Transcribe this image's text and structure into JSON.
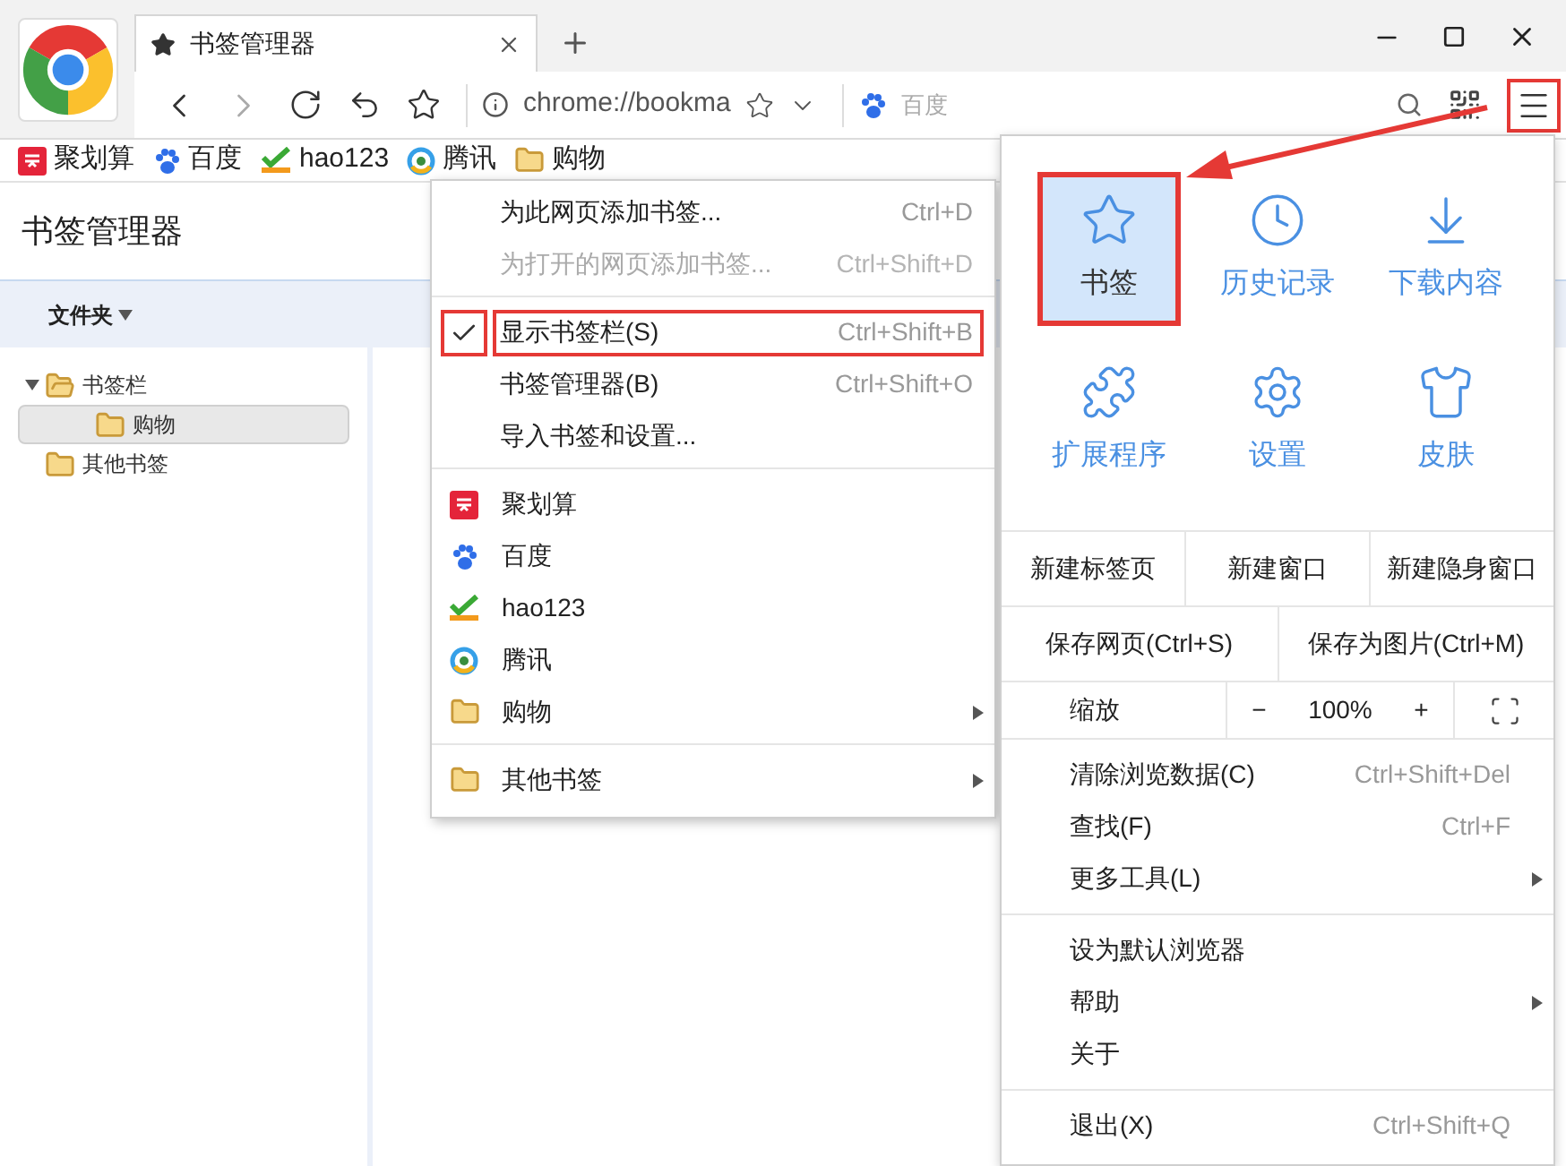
{
  "browser": {
    "tab_title": "书签管理器",
    "address": "chrome://bookma",
    "search_placeholder": "百度",
    "menu_button_highlighted": true
  },
  "bookmarks_bar": [
    {
      "label": "聚划算",
      "kind": "ju"
    },
    {
      "label": "百度",
      "kind": "baidu"
    },
    {
      "label": "hao123",
      "kind": "hao"
    },
    {
      "label": "腾讯",
      "kind": "tencent"
    },
    {
      "label": "购物",
      "kind": "folder"
    }
  ],
  "page": {
    "title": "书签管理器",
    "folder_menu": "文件夹",
    "tree": [
      {
        "label": "书签栏",
        "expanded": true,
        "selected": false,
        "children": [
          {
            "label": "购物",
            "selected": true
          }
        ]
      },
      {
        "label": "其他书签",
        "expanded": false,
        "selected": false
      }
    ]
  },
  "context_menu": {
    "sections": [
      [
        {
          "kind": "command",
          "label": "为此网页添加书签...",
          "shortcut": "Ctrl+D",
          "disabled": false,
          "checked": false,
          "highlighted": false
        },
        {
          "kind": "command",
          "label": "为打开的网页添加书签...",
          "shortcut": "Ctrl+Shift+D",
          "disabled": true,
          "checked": false,
          "highlighted": false
        }
      ],
      [
        {
          "kind": "command",
          "label": "显示书签栏(S)",
          "shortcut": "Ctrl+Shift+B",
          "disabled": false,
          "checked": true,
          "highlighted": true
        },
        {
          "kind": "command",
          "label": "书签管理器(B)",
          "shortcut": "Ctrl+Shift+O",
          "disabled": false,
          "checked": false,
          "highlighted": false
        },
        {
          "kind": "command",
          "label": "导入书签和设置...",
          "disabled": false,
          "checked": false,
          "highlighted": false
        }
      ],
      [
        {
          "kind": "ju",
          "label": "聚划算",
          "submenu": false
        },
        {
          "kind": "baidu",
          "label": "百度",
          "submenu": false
        },
        {
          "kind": "hao",
          "label": "hao123",
          "submenu": false
        },
        {
          "kind": "tencent",
          "label": "腾讯",
          "submenu": false
        },
        {
          "kind": "folder",
          "label": "购物",
          "submenu": true
        }
      ],
      [
        {
          "kind": "folder",
          "label": "其他书签",
          "submenu": true
        }
      ]
    ]
  },
  "main_menu": {
    "tiles": [
      {
        "kind": "star",
        "label": "书签",
        "selected": true,
        "highlighted": true
      },
      {
        "kind": "clock",
        "label": "历史记录",
        "selected": false,
        "highlighted": false
      },
      {
        "kind": "download",
        "label": "下载内容",
        "selected": false,
        "highlighted": false
      },
      {
        "kind": "extension",
        "label": "扩展程序",
        "selected": false,
        "highlighted": false
      },
      {
        "kind": "gear",
        "label": "设置",
        "selected": false,
        "highlighted": false
      },
      {
        "kind": "shirt",
        "label": "皮肤",
        "selected": false,
        "highlighted": false
      }
    ],
    "window_actions": [
      "新建标签页",
      "新建窗口",
      "新建隐身窗口"
    ],
    "save_actions": [
      "保存网页(Ctrl+S)",
      "保存为图片(Ctrl+M)"
    ],
    "zoom": {
      "label": "缩放",
      "minus": "−",
      "value": "100%",
      "plus": "+"
    },
    "sections": [
      [
        {
          "label": "清除浏览数据(C)",
          "shortcut": "Ctrl+Shift+Del",
          "submenu": false
        },
        {
          "label": "查找(F)",
          "shortcut": "Ctrl+F",
          "submenu": false
        },
        {
          "label": "更多工具(L)",
          "submenu": true
        }
      ],
      [
        {
          "label": "设为默认浏览器",
          "submenu": false
        },
        {
          "label": "帮助",
          "submenu": true
        },
        {
          "label": "关于",
          "submenu": false
        }
      ],
      [
        {
          "label": "退出(X)",
          "shortcut": "Ctrl+Shift+Q",
          "submenu": false
        }
      ]
    ]
  }
}
